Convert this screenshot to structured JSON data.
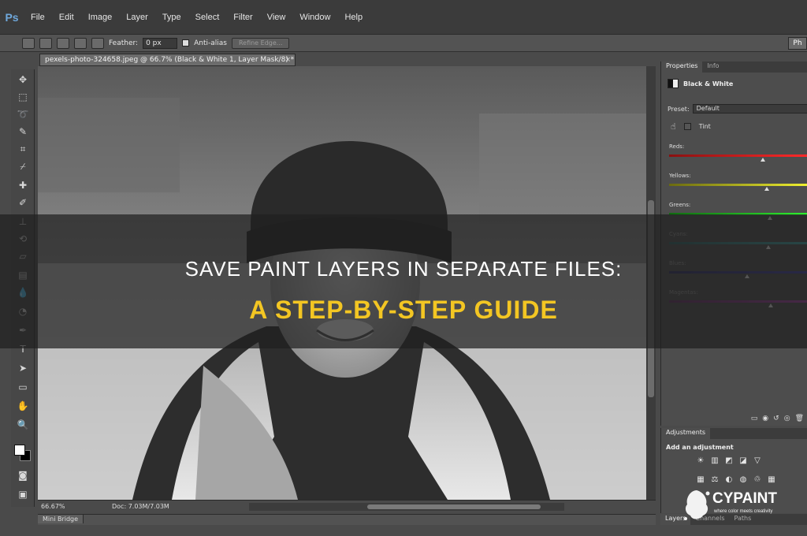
{
  "app": {
    "logo": "Ps",
    "menu": [
      "File",
      "Edit",
      "Image",
      "Layer",
      "Type",
      "Select",
      "Filter",
      "View",
      "Window",
      "Help"
    ]
  },
  "options": {
    "feather_label": "Feather:",
    "feather_value": "0 px",
    "antialias_label": "Anti-alias",
    "refine_label": "Refine Edge...",
    "right_button": "Ph"
  },
  "document": {
    "tab_title": "pexels-photo-324658.jpeg @ 66.7% (Black & White 1, Layer Mask/8) *",
    "tab_close": "×",
    "zoom": "66.67%",
    "doc_info": "Doc: 7.03M/7.03M"
  },
  "minibridge": {
    "label": "Mini Bridge"
  },
  "properties": {
    "tabs": [
      "Properties",
      "Info"
    ],
    "adjustment_name": "Black & White",
    "preset_label": "Preset:",
    "preset_value": "Default",
    "tint_label": "Tint",
    "sliders": [
      {
        "label": "Reds:",
        "value": 0.7,
        "color_from": "#8a1010",
        "color_to": "#ff2a2a"
      },
      {
        "label": "Yellows:",
        "value": 0.73,
        "color_from": "#6a6a10",
        "color_to": "#f0f030"
      },
      {
        "label": "Greens:",
        "value": 0.75,
        "color_from": "#106a10",
        "color_to": "#30f030"
      },
      {
        "label": "Cyans:",
        "value": 0.74,
        "color_from": "#106a6a",
        "color_to": "#30f0f0"
      },
      {
        "label": "Blues:",
        "value": 0.58,
        "color_from": "#10106a",
        "color_to": "#3030f0"
      },
      {
        "label": "Magentas:",
        "value": 0.76,
        "color_from": "#6a106a",
        "color_to": "#f030f0"
      }
    ]
  },
  "adjustments": {
    "tab": "Adjustments",
    "label": "Add an adjustment",
    "row1": [
      "☀",
      "▥",
      "◩",
      "◪",
      "▽"
    ],
    "row2": [
      "▦",
      "⚖",
      "◐",
      "◍",
      "♲",
      "▦"
    ]
  },
  "layers_tabs": [
    "Layers",
    "Channels",
    "Paths"
  ],
  "overlay": {
    "line1": "Save Paint Layers in Separate Files:",
    "line2": "A Step-by-Step Guide"
  },
  "watermark": {
    "name": "CYPAINT",
    "tagline": "where color meets creativity"
  },
  "colors": {
    "accent_yellow": "#f3c623",
    "ui_dark": "#3b3b3b"
  }
}
